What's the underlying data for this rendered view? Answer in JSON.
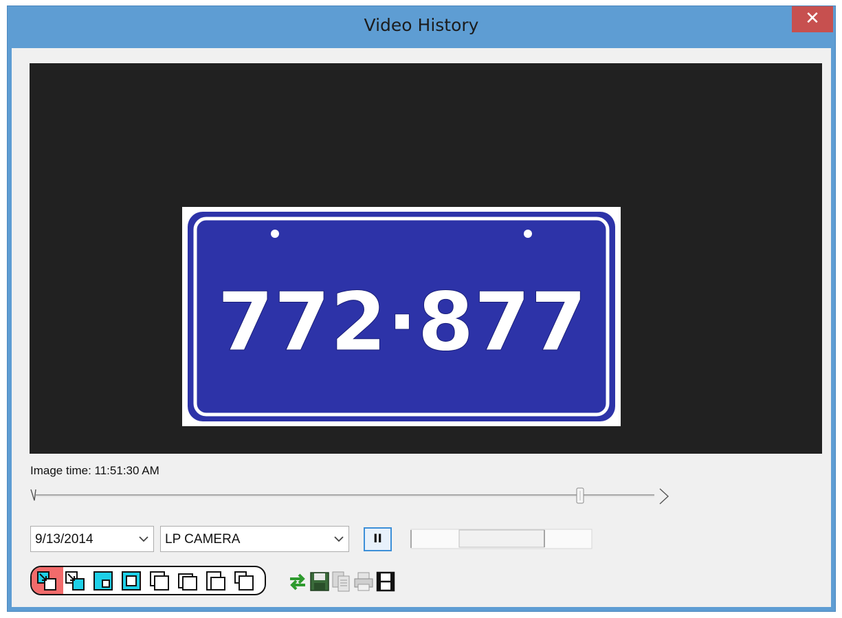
{
  "window": {
    "title": "Video History",
    "close_glyph": "✕"
  },
  "video": {
    "plate_text": "772·877",
    "plate_color": "#2d33a8"
  },
  "image_time": "Image time: 11:51:30 AM",
  "timeline": {
    "position": 0.88
  },
  "controls": {
    "date_value": "9/13/2014",
    "camera_value": "LP CAMERA",
    "pause_glyph": "II",
    "speed": 0.5
  },
  "layouts": [
    {
      "icon": "layout-1x1-icon"
    },
    {
      "icon": "layout-2x2-icon"
    },
    {
      "icon": "layout-3x3-icon"
    },
    {
      "icon": "layout-4x4-icon"
    },
    {
      "icon": "layout-5x5-icon"
    },
    {
      "icon": "layout-6x6-icon"
    },
    {
      "icon": "layout-7x7-icon"
    },
    {
      "icon": "layout-8x8-icon"
    }
  ],
  "tools": [
    {
      "icon": "refresh-icon"
    },
    {
      "icon": "save-icon"
    },
    {
      "icon": "copy-icon"
    },
    {
      "icon": "print-icon"
    },
    {
      "icon": "film-icon"
    }
  ],
  "colors": {
    "titlebar": "#5e9dd3",
    "close": "#c7504f",
    "layout_active": "#f26b6b",
    "layout_cyan": "#1ed0e8",
    "refresh": "#2e9a2e"
  }
}
